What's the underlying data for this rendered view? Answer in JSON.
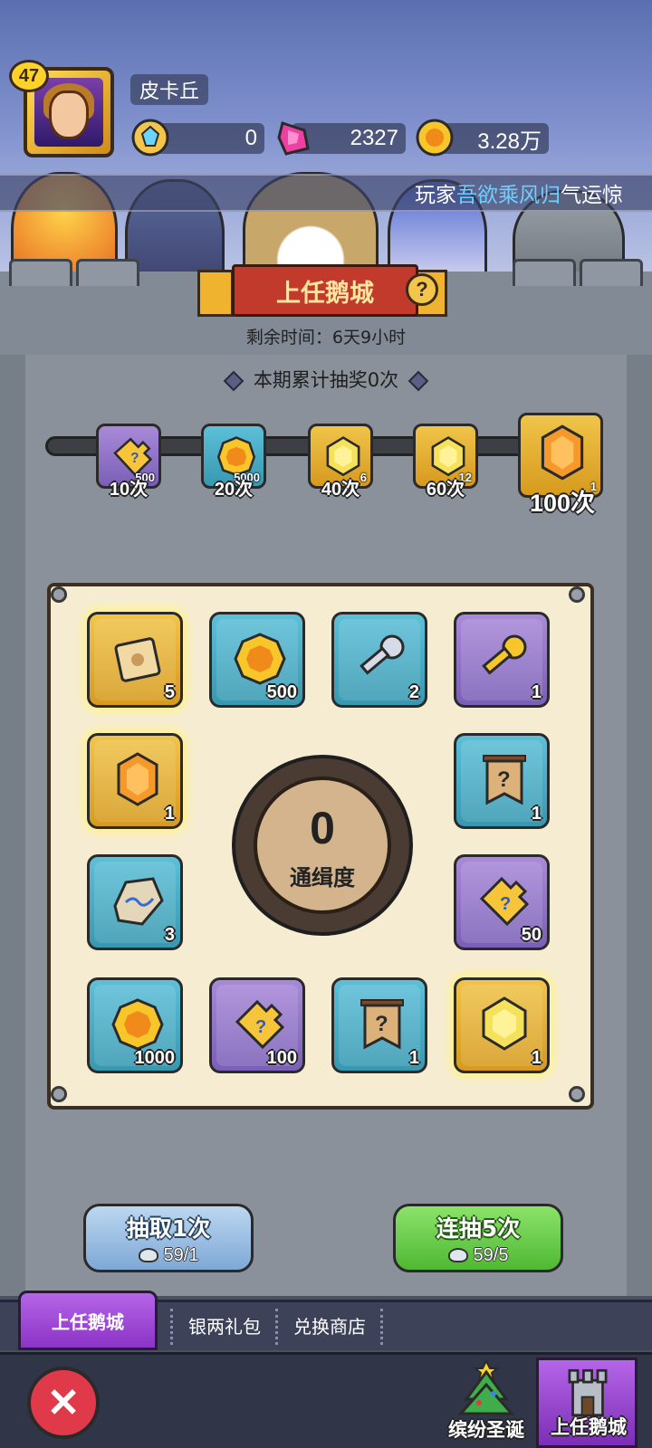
{
  "player": {
    "name": "皮卡丘",
    "level": "47"
  },
  "currencies": {
    "diamond": "0",
    "gem": "2327",
    "gold": "3.28万"
  },
  "marquee": {
    "prefix": "玩家",
    "highlight": "吾欲乘风归",
    "suffix": "气运惊"
  },
  "event": {
    "title": "上任鹅城",
    "help": "?",
    "remaining_label": "剩余时间：6天9小时"
  },
  "progress": {
    "title": "本期累计抽奖0次",
    "milestones": [
      {
        "label": "10次",
        "count": "500",
        "icon": "puzzle-piece-icon"
      },
      {
        "label": "20次",
        "count": "5000",
        "icon": "gold-coin-icon"
      },
      {
        "label": "40次",
        "count": "6",
        "icon": "yellow-gem-icon"
      },
      {
        "label": "60次",
        "count": "12",
        "icon": "yellow-gem-icon"
      },
      {
        "label": "100次",
        "count": "1",
        "icon": "orange-gem-icon"
      }
    ]
  },
  "board": {
    "items": [
      {
        "icon": "scroll-icon",
        "qty": "5"
      },
      {
        "icon": "gold-coin-icon",
        "qty": "500"
      },
      {
        "icon": "silver-key-icon",
        "qty": "2"
      },
      {
        "icon": "gold-key-icon",
        "qty": "1"
      },
      {
        "icon": "orange-gem-icon",
        "qty": "1"
      },
      {
        "icon": "mystery-banner-icon",
        "qty": "1"
      },
      {
        "icon": "rune-stone-icon",
        "qty": "3"
      },
      {
        "icon": "puzzle-piece-icon",
        "qty": "50"
      },
      {
        "icon": "gold-coin-icon",
        "qty": "1000"
      },
      {
        "icon": "puzzle-piece-icon",
        "qty": "100"
      },
      {
        "icon": "mystery-banner-icon",
        "qty": "1"
      },
      {
        "icon": "yellow-gem-icon",
        "qty": "1"
      }
    ],
    "center": {
      "value": "0",
      "label": "通缉度"
    }
  },
  "actions": {
    "draw_one": {
      "label": "抽取1次",
      "cost": "59/1"
    },
    "draw_five": {
      "label": "连抽5次",
      "cost": "59/5"
    }
  },
  "tabs": [
    "上任鹅城",
    "银两礼包",
    "兑换商店"
  ],
  "bottom_nav": {
    "close": "✕",
    "items": [
      "缤纷圣诞",
      "上任鹅城"
    ]
  }
}
